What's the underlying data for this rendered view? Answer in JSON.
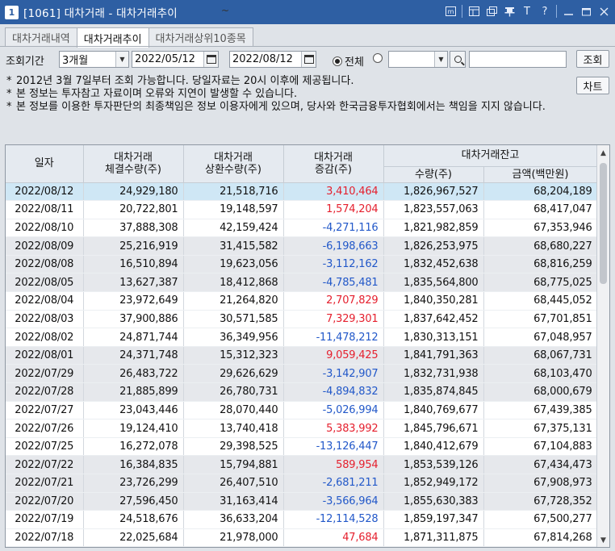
{
  "window": {
    "num": "1",
    "title": "[1061] 대차거래 - 대차거래추이",
    "tool_icons": [
      "m-icon",
      "layout-icon",
      "popout-icon",
      "pin-icon",
      "font-icon",
      "help-icon",
      "minimize-icon",
      "maximize-icon",
      "close-icon"
    ],
    "help_glyph": "?",
    "font_glyph": "T"
  },
  "tabs": [
    {
      "label": "대차거래내역",
      "active": false
    },
    {
      "label": "대차거래추이",
      "active": true
    },
    {
      "label": "대차거래상위10종목",
      "active": false
    }
  ],
  "filter": {
    "period_label": "조회기간",
    "period_value": "3개월",
    "start_date": "2022/05/12",
    "end_date": "2022/08/12",
    "tilde": "~",
    "radio_all_label": "전체",
    "radio_all_selected": true,
    "code_value": "",
    "name_value": "",
    "search_button": "조회",
    "chart_button": "차트"
  },
  "notes": [
    "2012년 3월 7일부터 조회 가능합니다. 당일자료는 20시 이후에 제공됩니다.",
    "본 정보는 투자참고 자료이며 오류와 지연이 발생할 수 있습니다.",
    "본 정보를 이용한 투자판단의 최종책임은 정보 이용자에게 있으며, 당사와 한국금융투자협회에서는 책임을 지지 않습니다."
  ],
  "note_bullet": "*",
  "table": {
    "headers": {
      "date": "일자",
      "contract_l1": "대차거래",
      "contract_l2": "체결수량(주)",
      "repay_l1": "대차거래",
      "repay_l2": "상환수량(주)",
      "change_l1": "대차거래",
      "change_l2": "증감(주)",
      "balance": "대차거래잔고",
      "qty": "수량(주)",
      "amount": "금액(백만원)"
    },
    "rows": [
      {
        "date": "2022/08/12",
        "contract": "24,929,180",
        "repay": "21,518,716",
        "change": "3,410,464",
        "qty": "1,826,967,527",
        "amount": "68,204,189"
      },
      {
        "date": "2022/08/11",
        "contract": "20,722,801",
        "repay": "19,148,597",
        "change": "1,574,204",
        "qty": "1,823,557,063",
        "amount": "68,417,047"
      },
      {
        "date": "2022/08/10",
        "contract": "37,888,308",
        "repay": "42,159,424",
        "change": "-4,271,116",
        "qty": "1,821,982,859",
        "amount": "67,353,946"
      },
      {
        "date": "2022/08/09",
        "contract": "25,216,919",
        "repay": "31,415,582",
        "change": "-6,198,663",
        "qty": "1,826,253,975",
        "amount": "68,680,227"
      },
      {
        "date": "2022/08/08",
        "contract": "16,510,894",
        "repay": "19,623,056",
        "change": "-3,112,162",
        "qty": "1,832,452,638",
        "amount": "68,816,259"
      },
      {
        "date": "2022/08/05",
        "contract": "13,627,387",
        "repay": "18,412,868",
        "change": "-4,785,481",
        "qty": "1,835,564,800",
        "amount": "68,775,025"
      },
      {
        "date": "2022/08/04",
        "contract": "23,972,649",
        "repay": "21,264,820",
        "change": "2,707,829",
        "qty": "1,840,350,281",
        "amount": "68,445,052"
      },
      {
        "date": "2022/08/03",
        "contract": "37,900,886",
        "repay": "30,571,585",
        "change": "7,329,301",
        "qty": "1,837,642,452",
        "amount": "67,701,851"
      },
      {
        "date": "2022/08/02",
        "contract": "24,871,744",
        "repay": "36,349,956",
        "change": "-11,478,212",
        "qty": "1,830,313,151",
        "amount": "67,048,957"
      },
      {
        "date": "2022/08/01",
        "contract": "24,371,748",
        "repay": "15,312,323",
        "change": "9,059,425",
        "qty": "1,841,791,363",
        "amount": "68,067,731"
      },
      {
        "date": "2022/07/29",
        "contract": "26,483,722",
        "repay": "29,626,629",
        "change": "-3,142,907",
        "qty": "1,832,731,938",
        "amount": "68,103,470"
      },
      {
        "date": "2022/07/28",
        "contract": "21,885,899",
        "repay": "26,780,731",
        "change": "-4,894,832",
        "qty": "1,835,874,845",
        "amount": "68,000,679"
      },
      {
        "date": "2022/07/27",
        "contract": "23,043,446",
        "repay": "28,070,440",
        "change": "-5,026,994",
        "qty": "1,840,769,677",
        "amount": "67,439,385"
      },
      {
        "date": "2022/07/26",
        "contract": "19,124,410",
        "repay": "13,740,418",
        "change": "5,383,992",
        "qty": "1,845,796,671",
        "amount": "67,375,131"
      },
      {
        "date": "2022/07/25",
        "contract": "16,272,078",
        "repay": "29,398,525",
        "change": "-13,126,447",
        "qty": "1,840,412,679",
        "amount": "67,104,883"
      },
      {
        "date": "2022/07/22",
        "contract": "16,384,835",
        "repay": "15,794,881",
        "change": "589,954",
        "qty": "1,853,539,126",
        "amount": "67,434,473"
      },
      {
        "date": "2022/07/21",
        "contract": "23,726,299",
        "repay": "26,407,510",
        "change": "-2,681,211",
        "qty": "1,852,949,172",
        "amount": "67,908,973"
      },
      {
        "date": "2022/07/20",
        "contract": "27,596,450",
        "repay": "31,163,414",
        "change": "-3,566,964",
        "qty": "1,855,630,383",
        "amount": "67,728,352"
      },
      {
        "date": "2022/07/19",
        "contract": "24,518,676",
        "repay": "36,633,204",
        "change": "-12,114,528",
        "qty": "1,859,197,347",
        "amount": "67,500,277"
      },
      {
        "date": "2022/07/18",
        "contract": "22,025,684",
        "repay": "21,978,000",
        "change": "47,684",
        "qty": "1,871,311,875",
        "amount": "67,814,268"
      }
    ]
  },
  "colors": {
    "titlebar": "#2e5fa3",
    "positive": "#e5202e",
    "negative": "#2258c9",
    "selected_row": "#cfe7f5",
    "shaded_row": "#e6e8ec"
  }
}
